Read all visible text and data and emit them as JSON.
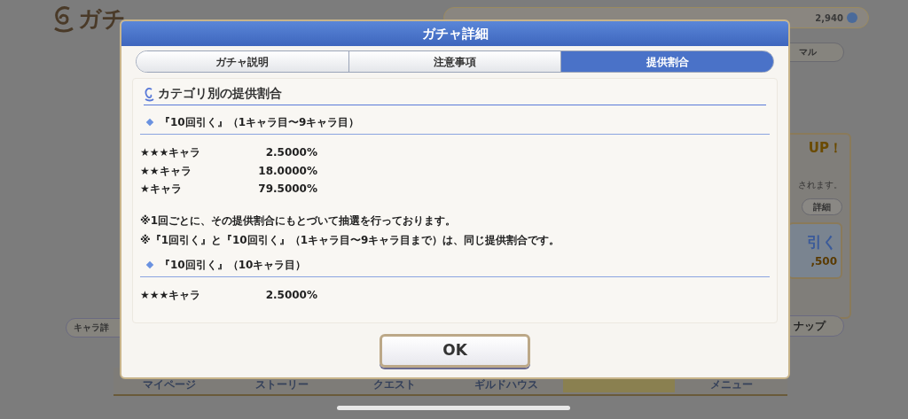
{
  "background": {
    "screen_title": "ガチ",
    "currency": "2,940",
    "tab_button": "マル",
    "banner_up": "UP！",
    "banner_note": "されます。",
    "detail_button": "詳細",
    "draw_button": "引く",
    "draw_cost": ",500",
    "character_button": "キャラ詳",
    "lineup_button": "ナップ",
    "nav": [
      {
        "label": "マイページ",
        "selected": false
      },
      {
        "label": "ストーリー",
        "selected": false
      },
      {
        "label": "クエスト",
        "selected": false
      },
      {
        "label": "ギルドハウス",
        "selected": false
      },
      {
        "selected": true
      },
      {
        "label": "メニュー",
        "selected": false
      }
    ]
  },
  "dialog": {
    "title": "ガチャ詳細",
    "tabs": [
      {
        "label": "ガチャ説明",
        "selected": false
      },
      {
        "label": "注意事項",
        "selected": false
      },
      {
        "label": "提供割合",
        "selected": true
      }
    ],
    "section_title": "カテゴリ別の提供割合",
    "sections": [
      {
        "heading": "『10回引く』（1キャラ目〜9キャラ目）",
        "rows": [
          {
            "rarity": "★★★キャラ",
            "rate": "2.5000%"
          },
          {
            "rarity": "★★キャラ",
            "rate": "18.0000%"
          },
          {
            "rarity": "★キャラ",
            "rate": "79.5000%"
          }
        ],
        "notes": [
          "※1回ごとに、その提供割合にもとづいて抽選を行っております。",
          "※『1回引く』と『10回引く』（1キャラ目〜9キャラ目まで）は、同じ提供割合です。"
        ]
      },
      {
        "heading": "『10回引く』（10キャラ目）",
        "rows": [
          {
            "rarity": "★★★キャラ",
            "rate": "2.5000%"
          }
        ]
      }
    ],
    "ok_button": "OK"
  }
}
